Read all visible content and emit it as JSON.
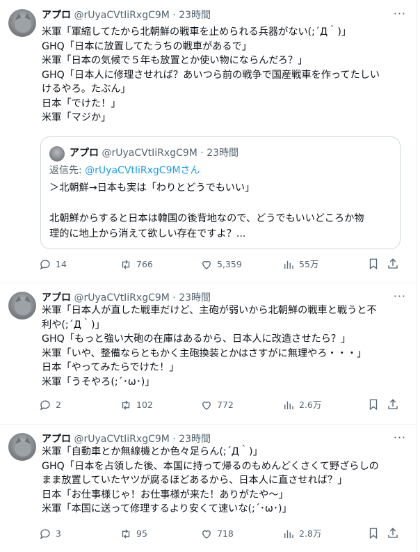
{
  "tweets": [
    {
      "author": "アプロ",
      "handle": "@rUyaCVtIiRxgC9M",
      "time": "23時間",
      "lines": [
        "米軍「軍縮してたから北朝鮮の戦車を止められる兵器がない(;´Д｀)」",
        "GHQ「日本に放置してたうちの戦車があるで」",
        "米軍「日本の気候で５年も放置とか使い物にならんだろ？」",
        "GHQ「日本人に修理させれば？あいつら前の戦争で国産戦車を作ってたしい",
        "けるやろ。たぶん」",
        "日本「でけた！」",
        "米軍「マジか」"
      ],
      "quote": {
        "author": "アプロ",
        "handle": "@rUyaCVtIiRxgC9M",
        "time": "23時間",
        "reply_prefix": "返信先: ",
        "reply_handle": "@rUyaCVtIiRxgC9Mさん",
        "lines": [
          "＞北朝鮮→日本も実は「わりとどうでもいい」",
          "",
          "北朝鮮からすると日本は韓国の後背地なので、どうでもいいどころか物",
          "理的に地上から消えて欲しい存在ですよ？..."
        ]
      },
      "stats": {
        "replies": "14",
        "reposts": "766",
        "likes": "5,359",
        "views": "55万"
      }
    },
    {
      "author": "アプロ",
      "handle": "@rUyaCVtIiRxgC9M",
      "time": "23時間",
      "lines": [
        "米軍「日本人が直した戦車だけど、主砲が弱いから北朝鮮の戦車と戦うと不",
        "利や(;´Д｀)」",
        "GHQ「もっと強い大砲の在庫はあるから、日本人に改造させたら？」",
        "米軍「いや、整備ならともかく主砲換装とかはさすがに無理やろ・・・」",
        "日本「やってみたらでけた！」",
        "米軍「うそやろ(;´･ω･)」"
      ],
      "stats": {
        "replies": "2",
        "reposts": "102",
        "likes": "772",
        "views": "2.6万"
      }
    },
    {
      "author": "アプロ",
      "handle": "@rUyaCVtIiRxgC9M",
      "time": "23時間",
      "lines": [
        "米軍「自動車とか無線機とか色々足らん(;´Д｀)」",
        "GHQ「日本を占領した後、本国に持って帰るのもめんどくさくて野ざらしの",
        "まま放置していたヤツが腐るほどあるから、日本人に直させれば？」",
        "日本「お仕事様じゃ！お仕事様が来た！ありがたや～」",
        "米軍「本国に送って修理するより安くて速いな(;´･ω･)」"
      ],
      "stats": {
        "replies": "3",
        "reposts": "95",
        "likes": "718",
        "views": "2.8万"
      }
    }
  ],
  "separator": " · ",
  "icons": [
    "more-icon",
    "reply-icon",
    "repost-icon",
    "like-icon",
    "views-icon",
    "bookmark-icon",
    "share-icon"
  ],
  "colors": {
    "text": "#0f1419",
    "muted": "#536471",
    "link": "#1d9bf0",
    "border": "#cfd9de"
  }
}
